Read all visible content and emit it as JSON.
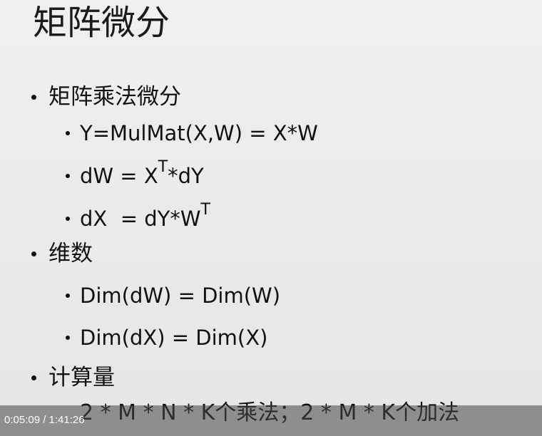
{
  "slide": {
    "title": "矩阵微分",
    "bullets": [
      {
        "label": "矩阵乘法微分",
        "items": [
          {
            "text": "Y=MulMat(X,W) = X*W"
          },
          {
            "pre": "dW = X",
            "sup": "T",
            "post": "*dY"
          },
          {
            "pre": "dX  = dY*W",
            "sup": "T",
            "post": ""
          }
        ]
      },
      {
        "label": "维数",
        "items": [
          {
            "text": "Dim(dW) = Dim(W)"
          },
          {
            "text": "Dim(dX) = Dim(X)"
          }
        ]
      },
      {
        "label": "计算量",
        "items": [
          {
            "text": "2 * M * N * K个乘法；2 * M * K个加法"
          }
        ]
      }
    ]
  },
  "player": {
    "time_display": "0:05:09 / 1:41:26"
  }
}
